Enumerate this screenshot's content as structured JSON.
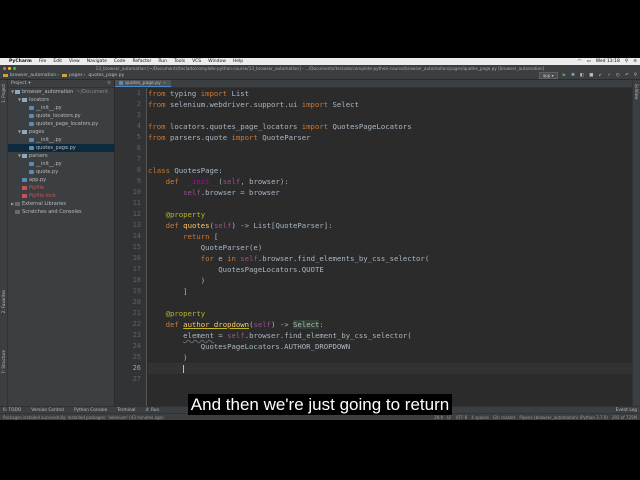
{
  "menubar": {
    "app_name": "PyCharm",
    "items": [
      "File",
      "Edit",
      "View",
      "Navigate",
      "Code",
      "Refactor",
      "Run",
      "Tools",
      "VCS",
      "Window",
      "Help"
    ],
    "clock": "Wed 13:18"
  },
  "titlebar": {
    "text": "13_browser_automation [~/Documents/teclado/complete-python-course/13_browser_automation] - .../Documents/teclado/complete-python-course/browser_automation/pages/quotes_page.py [browser_automation]"
  },
  "navbar": {
    "crumbs": [
      "browser_automation",
      "pages",
      "quotes_page.py"
    ],
    "run_config": "app"
  },
  "left_tools": {
    "project": "1: Project",
    "favorites": "2: Favorites",
    "structure": "7: Structure"
  },
  "right_tools": {
    "scientific": "SciView"
  },
  "project_panel": {
    "header": "Project",
    "tree": [
      {
        "label": "browser_automation",
        "extra": "~/Document",
        "level": 0,
        "icon": "folder",
        "arrow": "▼"
      },
      {
        "label": "locators",
        "level": 1,
        "icon": "folder",
        "arrow": "▼"
      },
      {
        "label": "__init__.py",
        "level": 2,
        "icon": "py",
        "arrow": ""
      },
      {
        "label": "quote_locators.py",
        "level": 2,
        "icon": "py",
        "arrow": ""
      },
      {
        "label": "quotes_page_locators.py",
        "level": 2,
        "icon": "py",
        "arrow": ""
      },
      {
        "label": "pages",
        "level": 1,
        "icon": "folder",
        "arrow": "▼"
      },
      {
        "label": "__init__.py",
        "level": 2,
        "icon": "py",
        "arrow": ""
      },
      {
        "label": "quotes_page.py",
        "level": 2,
        "icon": "py",
        "arrow": "",
        "selected": true
      },
      {
        "label": "parsers",
        "level": 1,
        "icon": "folder",
        "arrow": "▼"
      },
      {
        "label": "__init__.py",
        "level": 2,
        "icon": "py",
        "arrow": ""
      },
      {
        "label": "quote.py",
        "level": 2,
        "icon": "py",
        "arrow": ""
      },
      {
        "label": "app.py",
        "level": 1,
        "icon": "py",
        "arrow": ""
      },
      {
        "label": "Pipfile",
        "level": 1,
        "icon": "lock",
        "arrow": "",
        "color": "red"
      },
      {
        "label": "Pipfile.lock",
        "level": 1,
        "icon": "lock",
        "arrow": "",
        "color": "red"
      },
      {
        "label": "External Libraries",
        "level": 0,
        "icon": "ext",
        "arrow": "▶"
      },
      {
        "label": "Scratches and Consoles",
        "level": 0,
        "icon": "ext",
        "arrow": ""
      }
    ]
  },
  "editor": {
    "tab": "quotes_page.py",
    "line_numbers": [
      "1",
      "2",
      "3",
      "4",
      "5",
      "6",
      "7",
      "8",
      "9",
      "10",
      "11",
      "12",
      "13",
      "14",
      "15",
      "16",
      "17",
      "18",
      "19",
      "20",
      "21",
      "22",
      "23",
      "24",
      "25",
      "26",
      "27"
    ],
    "current_line": "26"
  },
  "bottom_tools": {
    "items": [
      "6: TODO",
      "Version Control",
      "Python Console",
      "Terminal",
      "4: Run"
    ],
    "right": "Event Log"
  },
  "statusbar": {
    "message": "Packages installed successfully: Installed packages: 'selenium' (43 minutes ago)",
    "right": [
      "26:9",
      "LF",
      "UTF-8",
      "4 spaces",
      "Git: master",
      "Pipenv (browser_automation) (Python 3.7.0)",
      "292 of 725M"
    ]
  },
  "caption": "And then we're just going to return",
  "colors": {
    "keyword": "#cc7832",
    "decorator": "#bbb529",
    "self": "#94558d",
    "function": "#ffc66d",
    "text": "#a9b7c6",
    "background": "#2b2b2b"
  }
}
